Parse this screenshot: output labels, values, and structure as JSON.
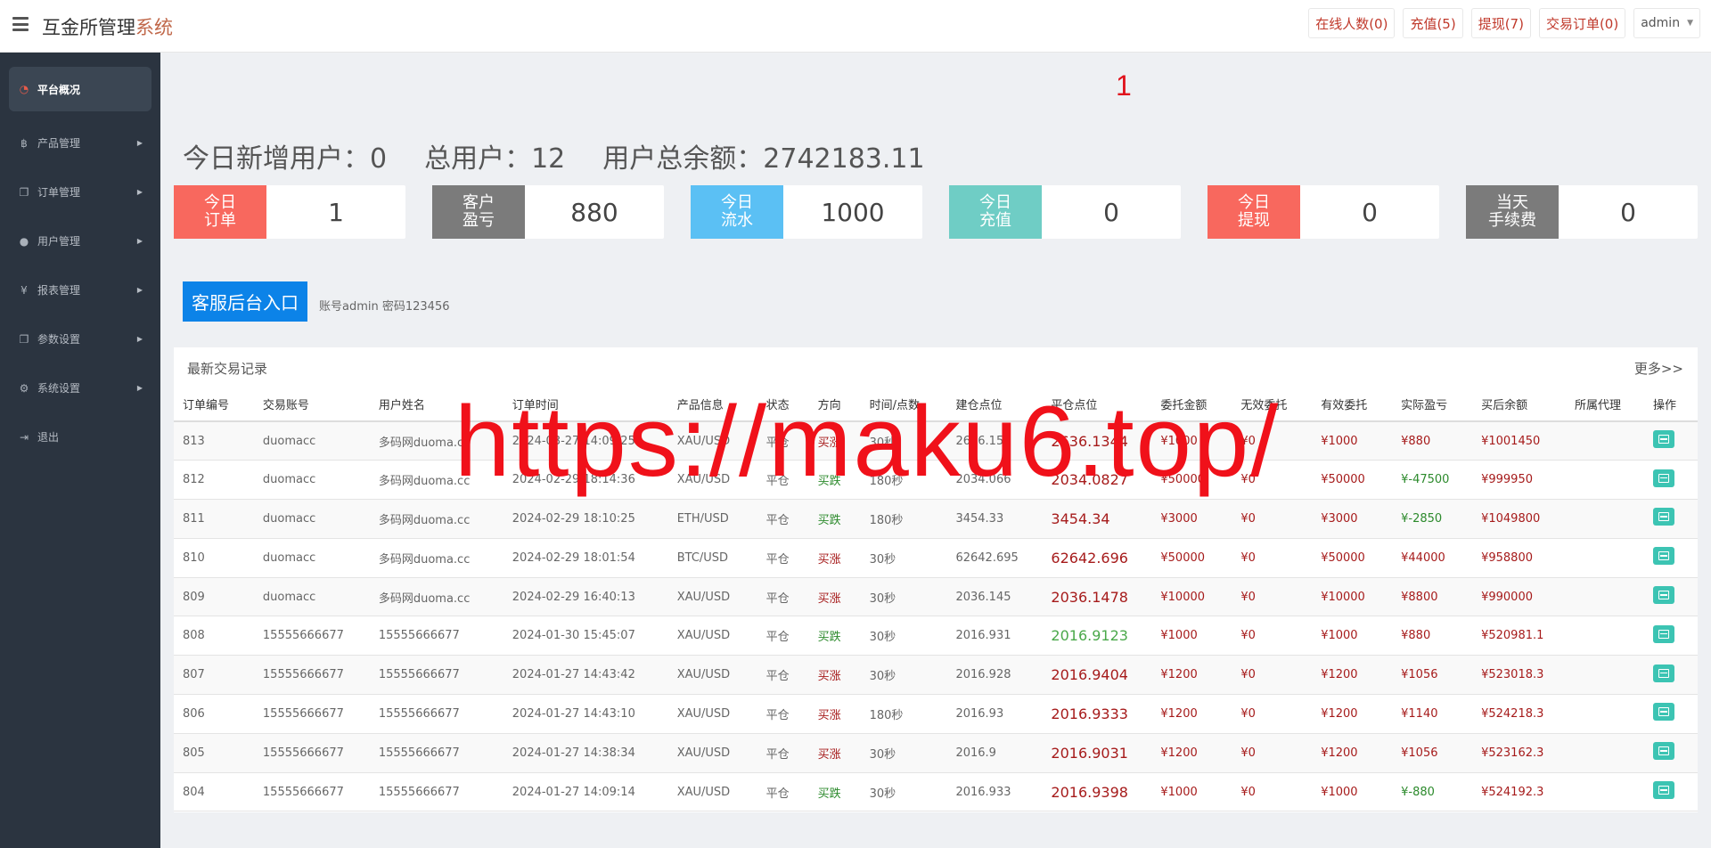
{
  "header": {
    "brand_main": "互金所管理",
    "brand_accent": "系统",
    "buttons": [
      "在线人数(0)",
      "充值(5)",
      "提现(7)",
      "交易订单(0)"
    ],
    "admin_label": "admin"
  },
  "sidebar": {
    "items": [
      {
        "label": "平台概况",
        "icon": "dashboard-icon"
      },
      {
        "label": "产品管理",
        "icon": "bitcoin-icon"
      },
      {
        "label": "订单管理",
        "icon": "copy-icon"
      },
      {
        "label": "用户管理",
        "icon": "user-icon"
      },
      {
        "label": "报表管理",
        "icon": "yen-icon"
      },
      {
        "label": "参数设置",
        "icon": "copy-icon"
      },
      {
        "label": "系统设置",
        "icon": "gears-icon"
      },
      {
        "label": "退出",
        "icon": "sign-out-icon"
      }
    ]
  },
  "watermark_small": "1",
  "watermark_url": "https://maku6.top/",
  "totals": {
    "new_users": "今日新增用户：0",
    "total_users": "总用户：12",
    "total_balance": "用户总余额：2742183.11"
  },
  "stats": [
    {
      "label": "今日\n订单",
      "value": "1",
      "color": "#f8685e"
    },
    {
      "label": "客户\n盈亏",
      "value": "880",
      "color": "#7b7b7b"
    },
    {
      "label": "今日\n流水",
      "value": "1000",
      "color": "#5bc0f4"
    },
    {
      "label": "今日\n充值",
      "value": "0",
      "color": "#6fcdc5"
    },
    {
      "label": "今日\n提现",
      "value": "0",
      "color": "#f8685e"
    },
    {
      "label": "当天\n手续费",
      "value": "0",
      "color": "#7b7b7b"
    }
  ],
  "kefu": {
    "button": "客服后台入口",
    "note": "账号admin 密码123456"
  },
  "panel": {
    "title": "最新交易记录",
    "more": "更多>>",
    "columns": [
      "订单编号",
      "交易账号",
      "用户姓名",
      "订单时间",
      "产品信息",
      "状态",
      "方向",
      "时间/点数",
      "建仓点位",
      "平仓点位",
      "委托金额",
      "无效委托",
      "有效委托",
      "实际盈亏",
      "买后余额",
      "所属代理",
      "操作"
    ],
    "rows": [
      [
        "813",
        "duomacc",
        "多码网duoma.cc",
        "2024-03-27 14:09:25",
        "XAU/USD",
        "平仓",
        "买涨",
        "30秒",
        "2636.151",
        "2636.1344",
        "¥1000",
        "¥0",
        "¥1000",
        "¥880",
        "¥1001450",
        ""
      ],
      [
        "812",
        "duomacc",
        "多码网duoma.cc",
        "2024-02-29 18:14:36",
        "XAU/USD",
        "平仓",
        "买跌",
        "180秒",
        "2034.066",
        "2034.0827",
        "¥50000",
        "¥0",
        "¥50000",
        "¥-47500",
        "¥999950",
        ""
      ],
      [
        "811",
        "duomacc",
        "多码网duoma.cc",
        "2024-02-29 18:10:25",
        "ETH/USD",
        "平仓",
        "买跌",
        "180秒",
        "3454.33",
        "3454.34",
        "¥3000",
        "¥0",
        "¥3000",
        "¥-2850",
        "¥1049800",
        ""
      ],
      [
        "810",
        "duomacc",
        "多码网duoma.cc",
        "2024-02-29 18:01:54",
        "BTC/USD",
        "平仓",
        "买涨",
        "30秒",
        "62642.695",
        "62642.696",
        "¥50000",
        "¥0",
        "¥50000",
        "¥44000",
        "¥958800",
        ""
      ],
      [
        "809",
        "duomacc",
        "多码网duoma.cc",
        "2024-02-29 16:40:13",
        "XAU/USD",
        "平仓",
        "买涨",
        "30秒",
        "2036.145",
        "2036.1478",
        "¥10000",
        "¥0",
        "¥10000",
        "¥8800",
        "¥990000",
        ""
      ],
      [
        "808",
        "15555666677",
        "15555666677",
        "2024-01-30 15:45:07",
        "XAU/USD",
        "平仓",
        "买跌",
        "30秒",
        "2016.931",
        "2016.9123",
        "¥1000",
        "¥0",
        "¥1000",
        "¥880",
        "¥520981.1",
        ""
      ],
      [
        "807",
        "15555666677",
        "15555666677",
        "2024-01-27 14:43:42",
        "XAU/USD",
        "平仓",
        "买涨",
        "30秒",
        "2016.928",
        "2016.9404",
        "¥1200",
        "¥0",
        "¥1200",
        "¥1056",
        "¥523018.3",
        ""
      ],
      [
        "806",
        "15555666677",
        "15555666677",
        "2024-01-27 14:43:10",
        "XAU/USD",
        "平仓",
        "买涨",
        "180秒",
        "2016.93",
        "2016.9333",
        "¥1200",
        "¥0",
        "¥1200",
        "¥1140",
        "¥524218.3",
        ""
      ],
      [
        "805",
        "15555666677",
        "15555666677",
        "2024-01-27 14:38:34",
        "XAU/USD",
        "平仓",
        "买涨",
        "30秒",
        "2016.9",
        "2016.9031",
        "¥1200",
        "¥0",
        "¥1200",
        "¥1056",
        "¥523162.3",
        ""
      ],
      [
        "804",
        "15555666677",
        "15555666677",
        "2024-01-27 14:09:14",
        "XAU/USD",
        "平仓",
        "买跌",
        "30秒",
        "2016.933",
        "2016.9398",
        "¥1000",
        "¥0",
        "¥1000",
        "¥-880",
        "¥524192.3",
        ""
      ]
    ]
  }
}
